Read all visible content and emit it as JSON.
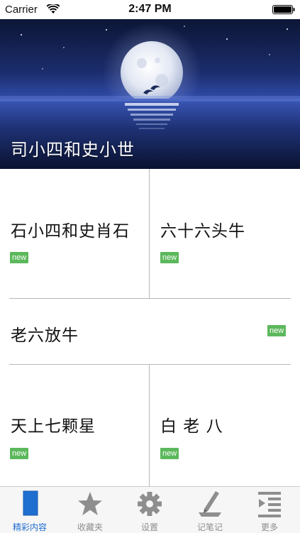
{
  "status_bar": {
    "carrier": "Carrier",
    "time": "2:47 PM"
  },
  "hero": {
    "title": "司小四和史小世"
  },
  "grid": {
    "items": [
      {
        "title": "石小四和史肖石",
        "badge": "new"
      },
      {
        "title": "六十六头牛",
        "badge": "new"
      },
      {
        "title": "老六放牛",
        "badge": "new"
      },
      {
        "title": "天上七颗星",
        "badge": "new"
      },
      {
        "title": "白 老 八",
        "badge": "new"
      }
    ]
  },
  "tab_bar": {
    "tabs": [
      {
        "label": "精彩内容",
        "icon": "document-icon",
        "active": true
      },
      {
        "label": "收藏夹",
        "icon": "star-icon",
        "active": false
      },
      {
        "label": "设置",
        "icon": "gear-icon",
        "active": false
      },
      {
        "label": "记笔记",
        "icon": "pen-icon",
        "active": false
      },
      {
        "label": "更多",
        "icon": "list-indent-icon",
        "active": false
      }
    ]
  },
  "colors": {
    "badge": "#5cb85c",
    "tab_active": "#1f6fd1",
    "tab_inactive": "#8e8e8e"
  }
}
